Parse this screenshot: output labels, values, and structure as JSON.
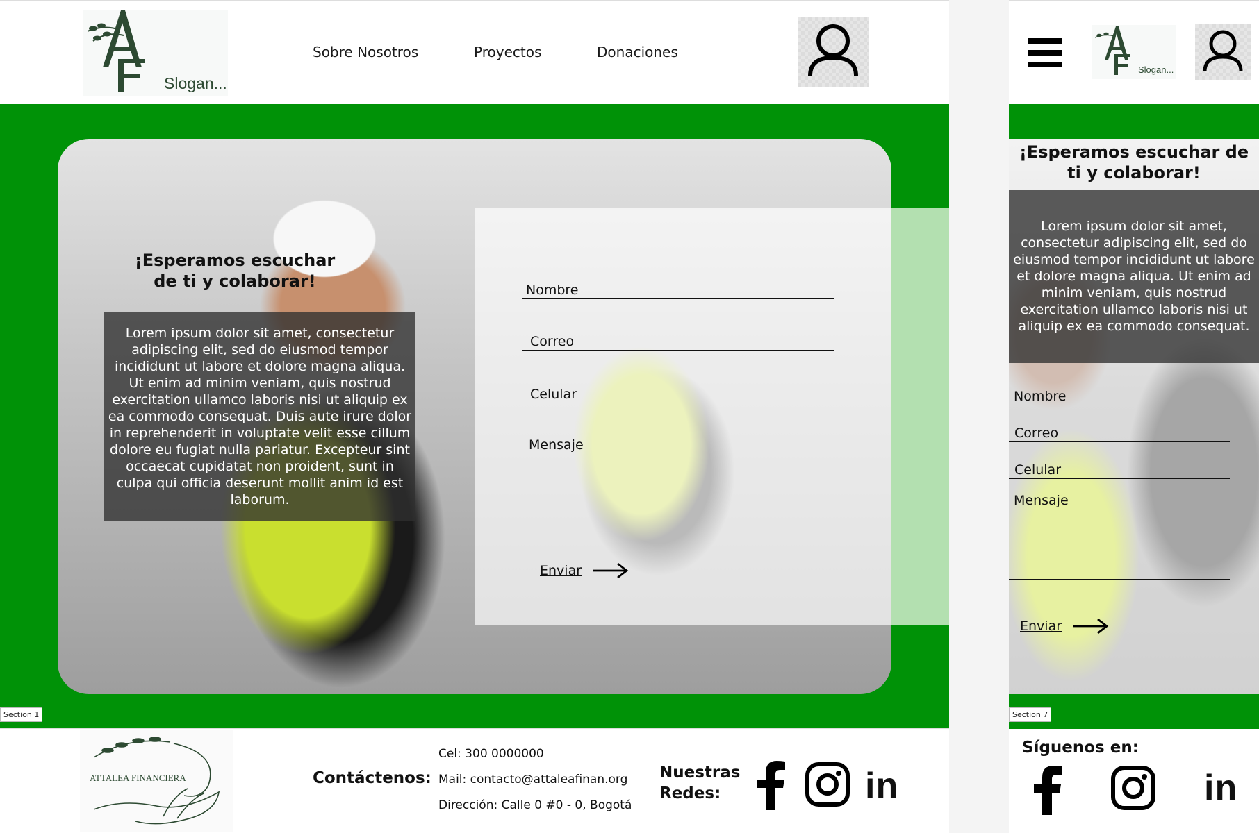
{
  "brand": {
    "slogan": "Slogan..."
  },
  "nav": {
    "items": [
      "Sobre Nosotros",
      "Proyectos",
      "Donaciones"
    ]
  },
  "hero": {
    "title": "¡Esperamos escuchar de ti y colaborar!",
    "body_desktop": "Lorem ipsum dolor sit amet, consectetur adipiscing elit, sed do eiusmod tempor incididunt ut labore et dolore magna aliqua. Ut enim ad minim veniam, quis nostrud exercitation ullamco laboris nisi ut aliquip ex ea commodo consequat. Duis aute irure dolor in reprehenderit in voluptate velit esse cillum dolore eu fugiat nulla pariatur. Excepteur sint occaecat cupidatat non proident, sunt in culpa qui officia deserunt mollit anim id est laborum.",
    "body_mobile": "Lorem ipsum dolor sit amet, consectetur adipiscing elit, sed do eiusmod tempor incididunt ut labore et dolore magna aliqua. Ut enim ad minim veniam, quis nostrud exercitation ullamco laboris nisi ut aliquip ex ea commodo consequat."
  },
  "form": {
    "name_label": "Nombre",
    "email_label": "Correo",
    "phone_label": "Celular",
    "message_label": "Mensaje",
    "send_label": "Enviar"
  },
  "sections": {
    "desktop": "Section 1",
    "mobile": "Section 7"
  },
  "footer": {
    "org_name": "ATTALEA FINANCIERA",
    "contact_title": "Contáctenos:",
    "phone": "Cel: 300 0000000",
    "mail": "Mail: contacto@attaleafinan.org",
    "address": "Dirección: Calle 0 #0 - 0, Bogotá",
    "social_title_line1": "Nuestras",
    "social_title_line2": "Redes:",
    "follow_title": "Síguenos en:",
    "linkedin_text": "in"
  },
  "colors": {
    "brand_green": "#009207",
    "light_green": "#b3e0b0",
    "logo_green": "#2d4a32"
  },
  "icons": [
    "user-icon",
    "menu-icon",
    "arrow-right-icon",
    "facebook-icon",
    "instagram-icon",
    "linkedin-icon"
  ]
}
